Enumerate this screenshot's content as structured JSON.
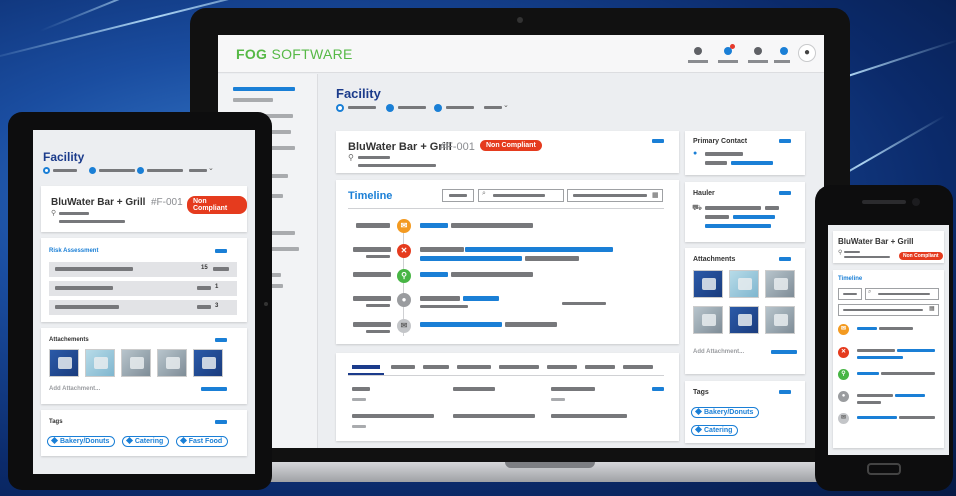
{
  "app": {
    "logo_prefix": "FOG",
    "logo_suffix": "SOFTWARE"
  },
  "colors": {
    "brand_green": "#56b946",
    "accent_blue": "#1a7fd6",
    "heading_navy": "#1b3b8b",
    "badge_red": "#e53b1e"
  },
  "page": {
    "title": "Facility"
  },
  "facility": {
    "name": "BluWater Bar + Grill",
    "id": "#F-001",
    "status": "Non Compliant"
  },
  "timeline": {
    "title": "Timeline",
    "calendar_icon": "calendar-icon",
    "search_icon": "search-icon"
  },
  "risk": {
    "title": "Risk Assessment",
    "rows": [
      {
        "value": "15"
      },
      {
        "value": "1"
      },
      {
        "value": "3"
      }
    ]
  },
  "sidebar": {
    "primary_contact": "Primary Contact",
    "hauler": "Hauler",
    "attachments": "Attachments",
    "add_attachment": "Add Attachment...",
    "tags": "Tags"
  },
  "tablet": {
    "attachments": "Attachements",
    "add_attachment": "Add Attachment...",
    "tags_title": "Tags"
  },
  "tags_laptop": [
    "Bakery/Donuts",
    "Catering"
  ],
  "tags_tablet": [
    "Bakery/Donuts",
    "Catering",
    "Fast Food"
  ],
  "timeline_icons": [
    "mail-icon",
    "close-icon",
    "search-icon",
    "user-icon",
    "envelope-icon"
  ]
}
